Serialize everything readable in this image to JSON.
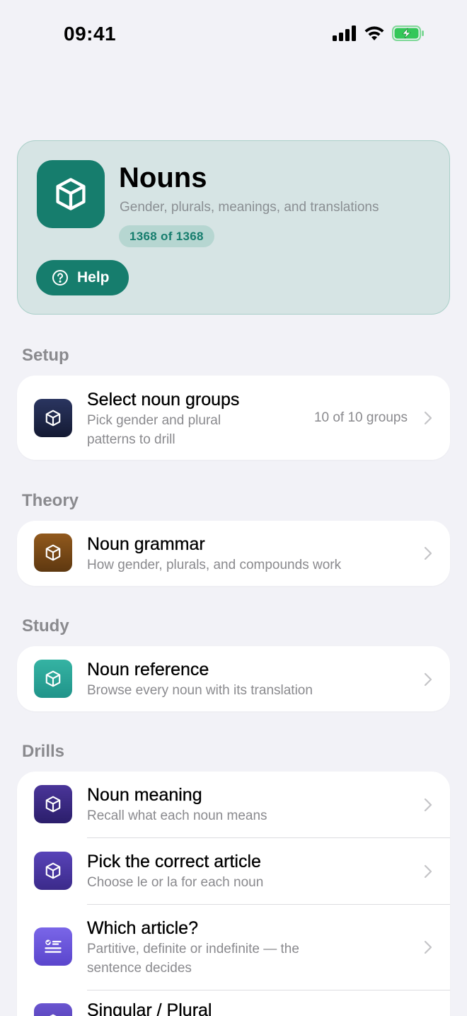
{
  "status_bar": {
    "time": "09:41"
  },
  "header": {
    "title": "Nouns",
    "subtitle": "Gender, plurals, meanings, and translations",
    "progress": "1368 of 1368",
    "help_label": "Help",
    "accent_color": "#167d6d"
  },
  "sections": {
    "setup": {
      "label": "Setup",
      "items": [
        {
          "title": "Select noun groups",
          "subtitle_line1": "Pick gender and plural",
          "subtitle_line2": "patterns to drill",
          "value": "10 of 10 groups",
          "icon": "cube-icon",
          "color": "#1d2647"
        }
      ]
    },
    "theory": {
      "label": "Theory",
      "items": [
        {
          "title": "Noun grammar",
          "subtitle": "How gender, plurals, and compounds work",
          "icon": "cube-icon",
          "color": "#7a4a16"
        }
      ]
    },
    "study": {
      "label": "Study",
      "items": [
        {
          "title": "Noun reference",
          "subtitle": "Browse every noun with its translation",
          "icon": "cube-icon",
          "color": "#2aa596"
        }
      ]
    },
    "drills": {
      "label": "Drills",
      "items": [
        {
          "title": "Noun meaning",
          "subtitle": "Recall what each noun means",
          "icon": "cube-icon",
          "color": "#3b2a86"
        },
        {
          "title": "Pick the correct article",
          "subtitle": "Choose le or la for each noun",
          "icon": "cube-icon",
          "color": "#4a35a0"
        },
        {
          "title": "Which article?",
          "subtitle_line1": "Partitive, definite or indefinite — the",
          "subtitle_line2": "sentence decides",
          "icon": "checklist-icon",
          "color": "#6a55d8"
        },
        {
          "title": "Singular / Plural",
          "icon": "cube-icon",
          "color": "#5a45c0"
        }
      ]
    }
  }
}
